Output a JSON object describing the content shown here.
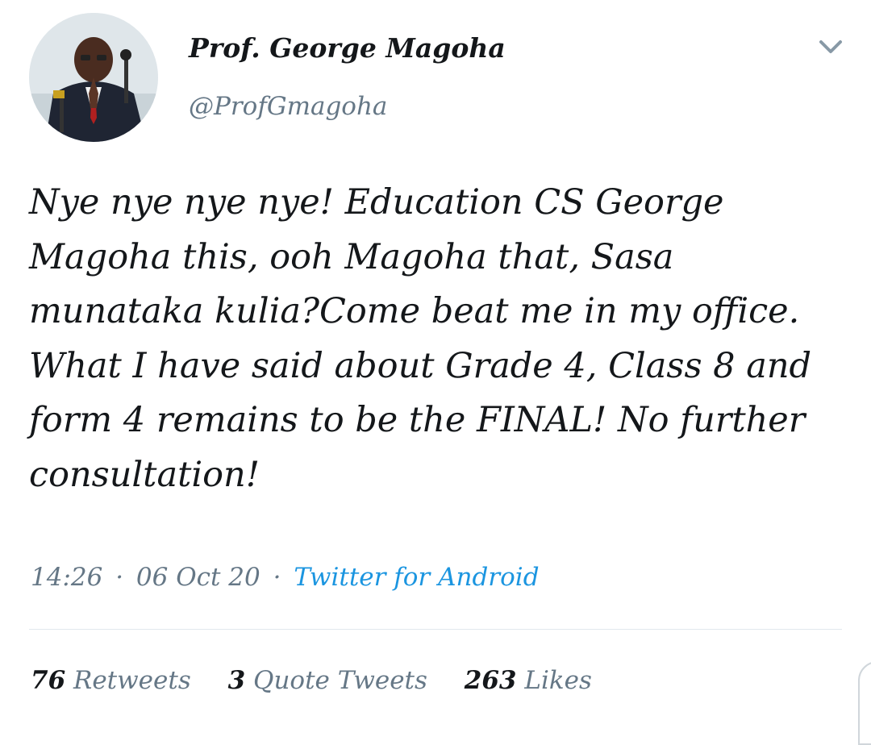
{
  "profile": {
    "display_name": "Prof. George Magoha",
    "handle": "@ProfGmagoha",
    "avatar_icon": "profile-photo",
    "menu_icon": "chevron-down-icon"
  },
  "tweet": {
    "paragraphs": [
      "Nye nye nye nye! Education CS George Magoha this, ooh Magoha that, Sasa munataka kulia?Come beat me in my office.",
      "What I have said about Grade 4, Class 8 and form 4 remains to be the FINAL! No further consultation!"
    ]
  },
  "meta": {
    "time": "14:26",
    "date": "06 Oct 20",
    "separator": "·",
    "source": "Twitter for Android"
  },
  "stats": {
    "retweets_count": "76",
    "retweets_label": "Retweets",
    "quotes_count": "3",
    "quotes_label": "Quote Tweets",
    "likes_count": "263",
    "likes_label": "Likes"
  },
  "colors": {
    "text": "#14171a",
    "secondary": "#657786",
    "link": "#1b95e0",
    "divider": "#e1e8ed"
  }
}
